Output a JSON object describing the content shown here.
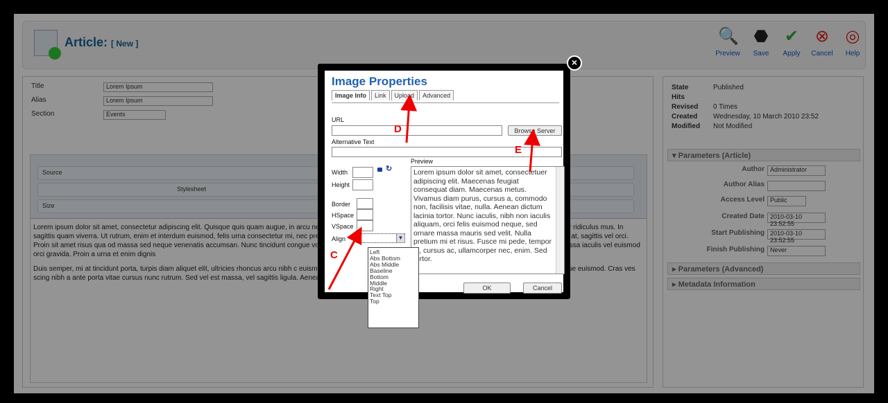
{
  "header": {
    "title": "Article:",
    "subtitle": "[ New ]",
    "toolbar": [
      {
        "label": "Preview",
        "icon": "search-icon",
        "glyph": "🔍"
      },
      {
        "label": "Save",
        "icon": "save-icon",
        "glyph": "⬣"
      },
      {
        "label": "Apply",
        "icon": "check-icon",
        "glyph": "✔"
      },
      {
        "label": "Cancel",
        "icon": "cancel-icon",
        "glyph": "⊗"
      },
      {
        "label": "Help",
        "icon": "help-icon",
        "glyph": "◎"
      }
    ]
  },
  "form": {
    "title_label": "Title",
    "title_value": "Lorem Ipsum",
    "alias_label": "Alias",
    "alias_value": "Lorem Ipsum",
    "section_label": "Section",
    "section_value": "Events"
  },
  "editor": {
    "source_label": "Source",
    "stylesheet_label": "Stylesheet",
    "size_label": "Size",
    "paragraph1": "Lorem ipsum dolor sit amet, consectetur adipiscing elit. Quisque quis quam augue, in arcu nec cursus. Cum sociis natoque penatibus et magnis dis parturient montes, nascetur ridiculus mus. In sagittis quam viverra. Ut rutrum, enim et interdum euismod, felis urna consectetur mi, nec pretium nunc urna Proin at volutpat tortor. Fusce leo justo, vestibulum eu scelerisque at, sagittis vel orci. Proin sit amet risus qua od massa sed neque venenatis accumsan. Nunc tincidunt congue volutpat. Phasellus ac lacus felis. Fusce v isse potenti. Proin imperdiet mauris at massa iaculis vel euismod orci gravida. Proin a urna et enim dignis",
    "paragraph2": "Duis semper, mi at tincidunt porta, turpis diam aliquet elit, ultricies rhoncus arcu nibh c euismod dictum neque at fermentum. Duis sodales orci vel orci aliquet at bibendum augue euismod. Cras ves scing nibh a ante porta vitae cursus nunc rutrum. Sed vel est massa, vel sagittis ligula. Aenean nunc ante, fa aucibus enim posuere sit amet."
  },
  "status": {
    "state_label": "State",
    "state_value": "Published",
    "hits_label": "Hits",
    "hits_value": "",
    "revised_label": "Revised",
    "revised_value": "0 Times",
    "created_label": "Created",
    "created_value": "Wednesday, 10 March 2010 23:52",
    "modified_label": "Modified",
    "modified_value": "Not Modified"
  },
  "params": {
    "header": "Parameters (Article)",
    "author_label": "Author",
    "author_value": "Administrator",
    "alias_label": "Author Alias",
    "alias_value": "",
    "access_label": "Access Level",
    "access_value": "Public",
    "created_label": "Created Date",
    "created_value": "2010-03-10 23:52:55",
    "start_label": "Start Publishing",
    "start_value": "2010-03-10 23:52:55",
    "finish_label": "Finish Publishing",
    "finish_value": "Never",
    "advanced_header": "Parameters (Advanced)",
    "metadata_header": "Metadata Information"
  },
  "modal": {
    "title": "Image Properties",
    "tabs": [
      "Image Info",
      "Link",
      "Upload",
      "Advanced"
    ],
    "url_label": "URL",
    "browse_label": "Browse Server",
    "alt_label": "Alternative Text",
    "width_label": "Width",
    "height_label": "Height",
    "border_label": "Border",
    "hspace_label": "HSpace",
    "vspace_label": "VSpace",
    "align_label": "Align",
    "preview_label": "Preview",
    "preview_text": "Lorem ipsum dolor sit amet, consectetuer adipiscing elit. Maecenas feugiat consequat diam. Maecenas metus. Vivamus diam purus, cursus a, commodo non, facilisis vitae, nulla. Aenean dictum lacinia tortor. Nunc iaculis, nibh non iaculis aliquam, orci felis euismod neque, sed ornare massa mauris sed velit. Nulla pretium mi et risus. Fusce mi pede, tempor id, cursus ac, ullamcorper nec, enim. Sed tortor.",
    "ok_label": "OK",
    "cancel_label": "Cancel",
    "close_glyph": "×"
  },
  "align_options": [
    "Left",
    "Abs Bottom",
    "Abs Middle",
    "Baseline",
    "Bottom",
    "Middle",
    "Right",
    "Text Top",
    "Top"
  ],
  "annotations": {
    "c": "C",
    "d": "D",
    "e": "E"
  },
  "colors": {
    "accent": "#1f62b0",
    "arrow": "#e00000"
  }
}
